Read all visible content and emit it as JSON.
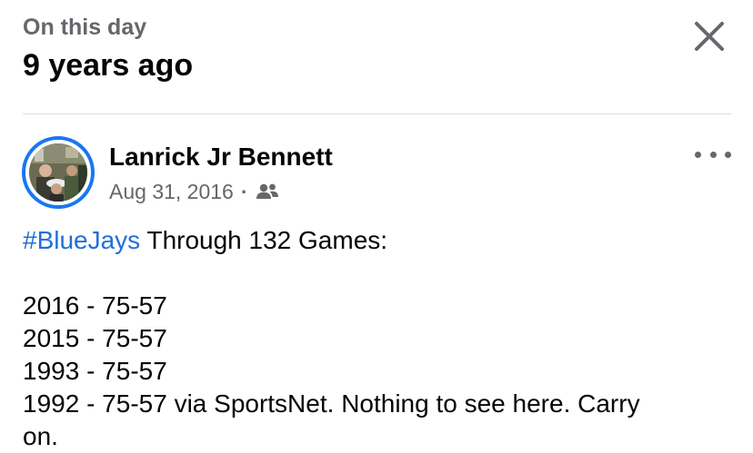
{
  "header": {
    "subtitle": "On this day",
    "title": "9 years ago"
  },
  "post": {
    "author": "Lanrick Jr Bennett",
    "date": "Aug 31, 2016",
    "separator": "·",
    "audience_icon": "friends-icon",
    "hashtag": "#BlueJays",
    "intro_rest": " Through 132 Games:",
    "lines": [
      "2016 - 75-57",
      "2015 - 75-57",
      "1993 - 75-57",
      "1992 - 75-57 via SportsNet. Nothing to see here. Carry",
      "on."
    ]
  },
  "colors": {
    "accent": "#1877f2",
    "hashtag": "#216fdb",
    "secondary_text": "#65676b",
    "divider": "#dadde1"
  },
  "icons": {
    "close": "close-icon",
    "more": "more-options-icon",
    "avatar": "avatar-photo"
  }
}
